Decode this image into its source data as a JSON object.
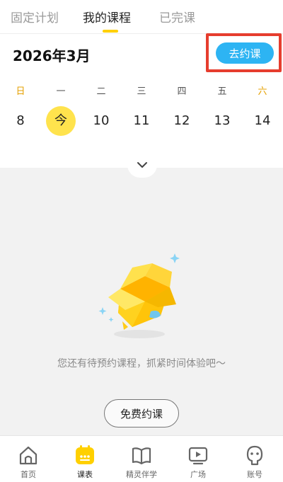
{
  "tabs": [
    {
      "label": "固定计划"
    },
    {
      "label": "我的课程"
    },
    {
      "label": "已完课"
    }
  ],
  "header": {
    "month_title": "2026年3月",
    "book_button": "去约课"
  },
  "weekdays": [
    "日",
    "一",
    "二",
    "三",
    "四",
    "五",
    "六"
  ],
  "dates": [
    "8",
    "今",
    "10",
    "11",
    "12",
    "13",
    "14"
  ],
  "empty_state": {
    "message": "您还有待预约课程，抓紧时间体验吧～",
    "button": "免费约课"
  },
  "bottom_nav": [
    {
      "label": "首页",
      "icon": "home-icon"
    },
    {
      "label": "课表",
      "icon": "schedule-icon"
    },
    {
      "label": "精灵伴学",
      "icon": "book-icon"
    },
    {
      "label": "广场",
      "icon": "tv-play-icon"
    },
    {
      "label": "账号",
      "icon": "account-icon"
    }
  ],
  "colors": {
    "accent_yellow": "#ffd000",
    "today_yellow": "#ffe34d",
    "button_blue": "#2db4f3",
    "highlight_red": "#e63d2e"
  }
}
